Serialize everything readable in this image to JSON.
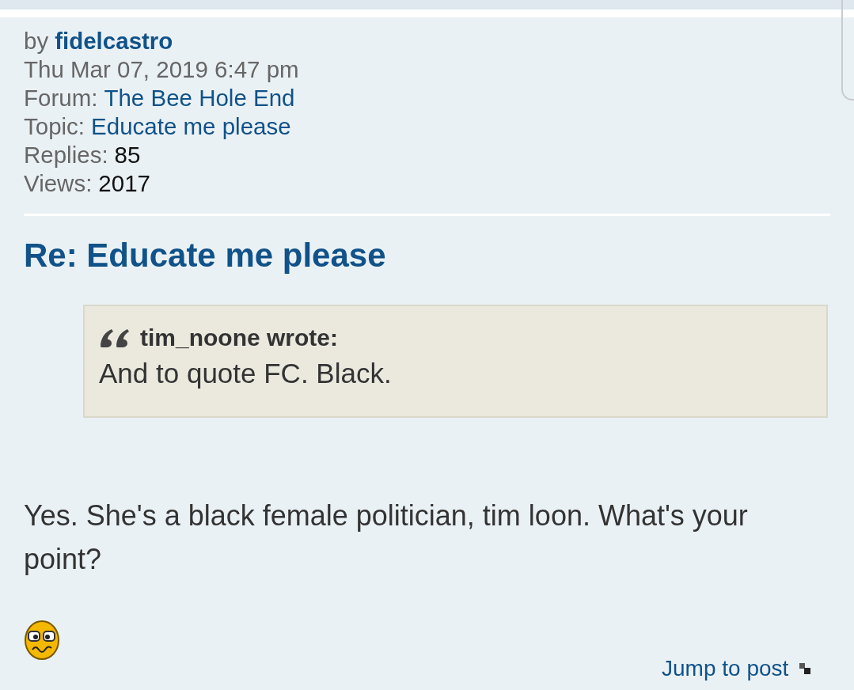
{
  "author": {
    "label": "by",
    "name": "fidelcastro"
  },
  "date": "Thu Mar 07, 2019 6:47 pm",
  "details": [
    {
      "label": "Forum:",
      "value": "The Bee Hole End",
      "kind": "link"
    },
    {
      "label": "Topic:",
      "value": "Educate me please",
      "kind": "link"
    },
    {
      "label": "Replies:",
      "value": "85",
      "kind": "plain"
    },
    {
      "label": "Views:",
      "value": "2017",
      "kind": "plain"
    }
  ],
  "post": {
    "title": "Re: Educate me please",
    "quote": {
      "author": "tim_noone wrote:",
      "text": "And to quote FC. Black."
    },
    "text": "Yes. She's a black female politician, tim loon. What's your point?",
    "jump_link": "Jump to post"
  }
}
